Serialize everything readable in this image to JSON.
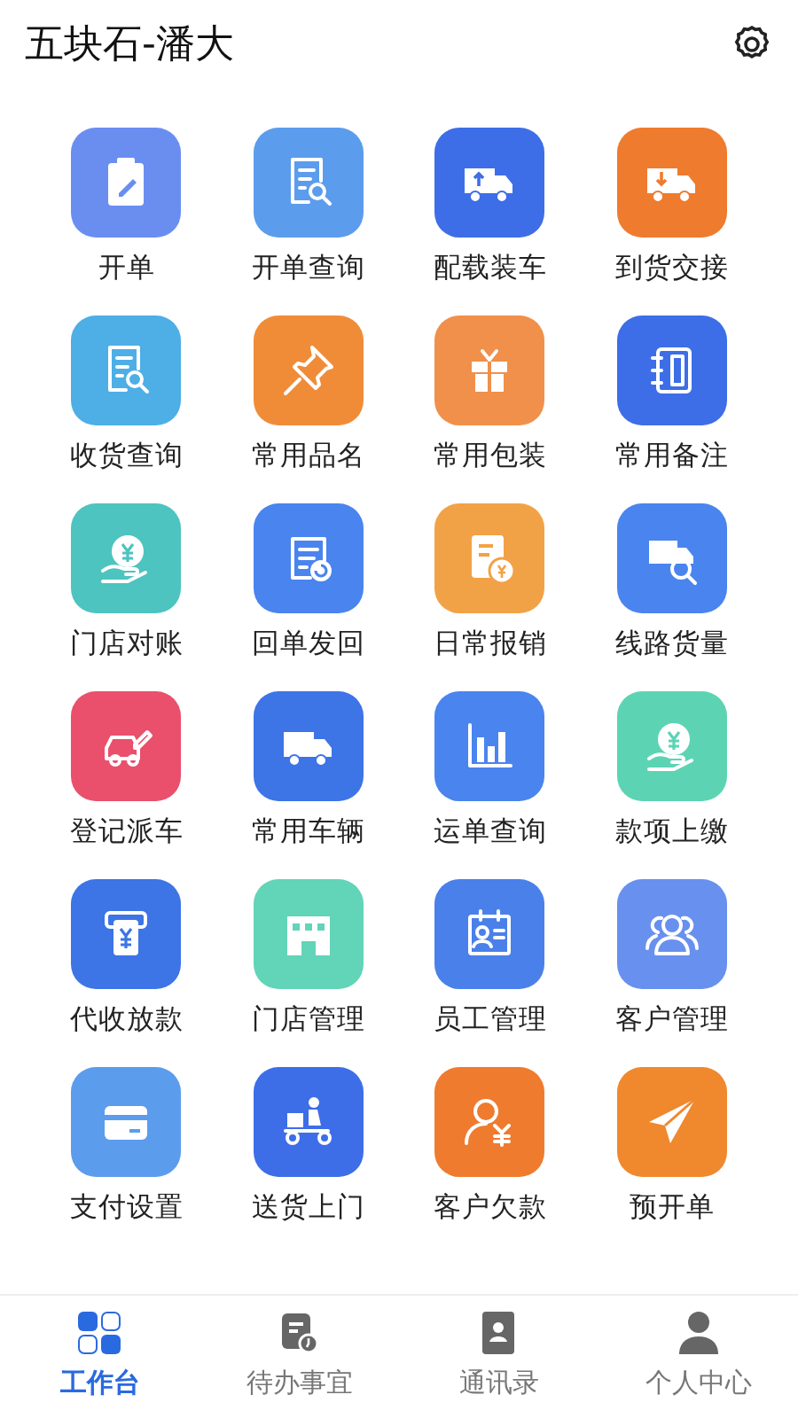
{
  "header": {
    "title": "五块石-潘大"
  },
  "tiles": [
    {
      "label": "开单",
      "color": "#6a8ef0"
    },
    {
      "label": "开单查询",
      "color": "#5c9cec"
    },
    {
      "label": "配载装车",
      "color": "#3d6ee8"
    },
    {
      "label": "到货交接",
      "color": "#ef7b2e"
    },
    {
      "label": "收货查询",
      "color": "#4eaee6"
    },
    {
      "label": "常用品名",
      "color": "#f08c38"
    },
    {
      "label": "常用包装",
      "color": "#f0904a"
    },
    {
      "label": "常用备注",
      "color": "#3d6ee8"
    },
    {
      "label": "门店对账",
      "color": "#4dc4c0"
    },
    {
      "label": "回单发回",
      "color": "#4a84ee"
    },
    {
      "label": "日常报销",
      "color": "#f2a246"
    },
    {
      "label": "线路货量",
      "color": "#4a84ee"
    },
    {
      "label": "登记派车",
      "color": "#ea4f6c"
    },
    {
      "label": "常用车辆",
      "color": "#3d74e6"
    },
    {
      "label": "运单查询",
      "color": "#4a84ee"
    },
    {
      "label": "款项上缴",
      "color": "#5cd4b4"
    },
    {
      "label": "代收放款",
      "color": "#3d74e6"
    },
    {
      "label": "门店管理",
      "color": "#62d4b8"
    },
    {
      "label": "员工管理",
      "color": "#4a80ea"
    },
    {
      "label": "客户管理",
      "color": "#6890ee"
    },
    {
      "label": "支付设置",
      "color": "#5c9cec"
    },
    {
      "label": "送货上门",
      "color": "#3d6ee8"
    },
    {
      "label": "客户欠款",
      "color": "#ef7b2e"
    },
    {
      "label": "预开单",
      "color": "#f0882e"
    }
  ],
  "tabbar": [
    {
      "label": "工作台",
      "selected": true
    },
    {
      "label": "待办事宜",
      "selected": false
    },
    {
      "label": "通讯录",
      "selected": false
    },
    {
      "label": "个人中心",
      "selected": false
    }
  ]
}
